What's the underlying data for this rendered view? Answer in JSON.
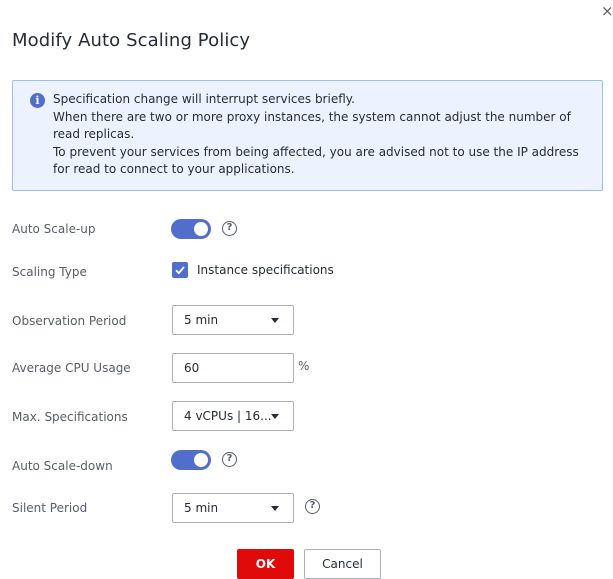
{
  "dialog": {
    "title": "Modify Auto Scaling Policy",
    "close_glyph": "×"
  },
  "alert": {
    "icon": "info-icon",
    "icon_glyph": "i",
    "line1": "Specification change will interrupt services briefly.",
    "line2": "When there are two or more proxy instances, the system cannot adjust the number of read replicas.",
    "line3": "To prevent your services from being affected, you are advised not to use the IP address for read to connect to your applications."
  },
  "form": {
    "auto_scale_up": {
      "label": "Auto Scale-up",
      "enabled": true
    },
    "scaling_type": {
      "label": "Scaling Type",
      "option_label": "Instance specifications",
      "checked": true
    },
    "observation_period": {
      "label": "Observation Period",
      "value": "5 min"
    },
    "avg_cpu": {
      "label": "Average CPU Usage",
      "value": "60",
      "unit": "%"
    },
    "max_spec": {
      "label": "Max. Specifications",
      "value": "4 vCPUs | 16..."
    },
    "auto_scale_down": {
      "label": "Auto Scale-down",
      "enabled": true
    },
    "silent_period": {
      "label": "Silent Period",
      "value": "5 min"
    },
    "help_glyph": "?"
  },
  "footer": {
    "ok_label": "OK",
    "cancel_label": "Cancel"
  },
  "colors": {
    "accent": "#526ecc",
    "danger": "#e10a0a",
    "alert_bg": "#edf3fe"
  }
}
